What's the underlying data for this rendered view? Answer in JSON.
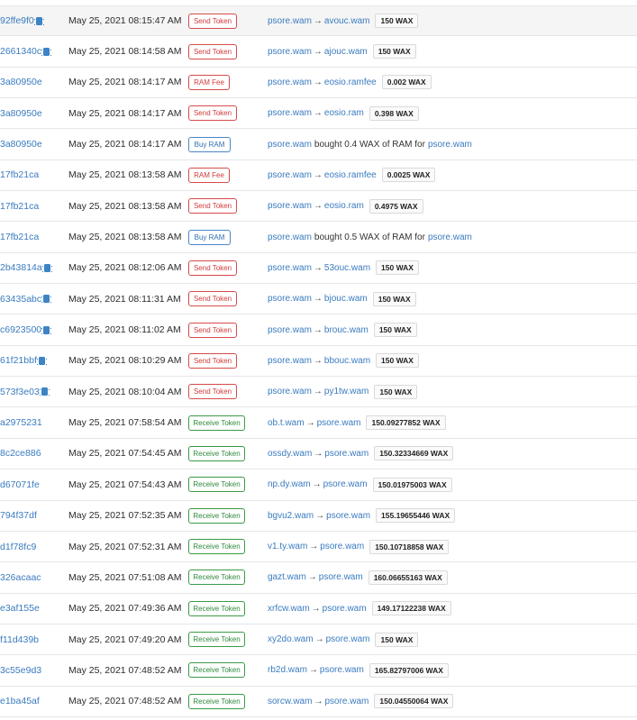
{
  "rows": [
    {
      "hash": "92ffe9f0",
      "cpu": true,
      "date": "May 25, 2021 08:15:47 AM",
      "type": "Send Token",
      "kind": "send",
      "from": "psore.wam",
      "to": "avouc.wam",
      "amount": "150 WAX"
    },
    {
      "hash": "2661340c",
      "cpu": true,
      "date": "May 25, 2021 08:14:58 AM",
      "type": "Send Token",
      "kind": "send",
      "from": "psore.wam",
      "to": "ajouc.wam",
      "amount": "150 WAX"
    },
    {
      "hash": "3a80950e",
      "cpu": false,
      "date": "May 25, 2021 08:14:17 AM",
      "type": "RAM Fee",
      "kind": "ram",
      "from": "psore.wam",
      "to": "eosio.ramfee",
      "amount": "0.002 WAX"
    },
    {
      "hash": "3a80950e",
      "cpu": false,
      "date": "May 25, 2021 08:14:17 AM",
      "type": "Send Token",
      "kind": "send",
      "from": "psore.wam",
      "to": "eosio.ram",
      "amount": "0.398 WAX"
    },
    {
      "hash": "3a80950e",
      "cpu": false,
      "date": "May 25, 2021 08:14:17 AM",
      "type": "Buy RAM",
      "kind": "buy",
      "buyer": "psore.wam",
      "mid": "bought 0.4 WAX of RAM for",
      "receiver": "psore.wam"
    },
    {
      "hash": "17fb21ca",
      "cpu": false,
      "date": "May 25, 2021 08:13:58 AM",
      "type": "RAM Fee",
      "kind": "ram",
      "from": "psore.wam",
      "to": "eosio.ramfee",
      "amount": "0.0025 WAX"
    },
    {
      "hash": "17fb21ca",
      "cpu": false,
      "date": "May 25, 2021 08:13:58 AM",
      "type": "Send Token",
      "kind": "send",
      "from": "psore.wam",
      "to": "eosio.ram",
      "amount": "0.4975 WAX"
    },
    {
      "hash": "17fb21ca",
      "cpu": false,
      "date": "May 25, 2021 08:13:58 AM",
      "type": "Buy RAM",
      "kind": "buy",
      "buyer": "psore.wam",
      "mid": "bought 0.5 WAX of RAM for",
      "receiver": "psore.wam"
    },
    {
      "hash": "2b43814a",
      "cpu": true,
      "date": "May 25, 2021 08:12:06 AM",
      "type": "Send Token",
      "kind": "send",
      "from": "psore.wam",
      "to": "53ouc.wam",
      "amount": "150 WAX"
    },
    {
      "hash": "63435abc",
      "cpu": true,
      "date": "May 25, 2021 08:11:31 AM",
      "type": "Send Token",
      "kind": "send",
      "from": "psore.wam",
      "to": "bjouc.wam",
      "amount": "150 WAX"
    },
    {
      "hash": "c6923500",
      "cpu": true,
      "date": "May 25, 2021 08:11:02 AM",
      "type": "Send Token",
      "kind": "send",
      "from": "psore.wam",
      "to": "brouc.wam",
      "amount": "150 WAX"
    },
    {
      "hash": "61f21bbf",
      "cpu": true,
      "date": "May 25, 2021 08:10:29 AM",
      "type": "Send Token",
      "kind": "send",
      "from": "psore.wam",
      "to": "bbouc.wam",
      "amount": "150 WAX"
    },
    {
      "hash": "573f3e03",
      "cpu": true,
      "date": "May 25, 2021 08:10:04 AM",
      "type": "Send Token",
      "kind": "send",
      "from": "psore.wam",
      "to": "py1tw.wam",
      "amount": "150 WAX"
    },
    {
      "hash": "a2975231",
      "cpu": false,
      "date": "May 25, 2021 07:58:54 AM",
      "type": "Receive Token",
      "kind": "recv",
      "from": "ob.t.wam",
      "to": "psore.wam",
      "amount": "150.09277852 WAX"
    },
    {
      "hash": "8c2ce886",
      "cpu": false,
      "date": "May 25, 2021 07:54:45 AM",
      "type": "Receive Token",
      "kind": "recv",
      "from": "ossdy.wam",
      "to": "psore.wam",
      "amount": "150.32334669 WAX"
    },
    {
      "hash": "d67071fe",
      "cpu": false,
      "date": "May 25, 2021 07:54:43 AM",
      "type": "Receive Token",
      "kind": "recv",
      "from": "np.dy.wam",
      "to": "psore.wam",
      "amount": "150.01975003 WAX"
    },
    {
      "hash": "794f37df",
      "cpu": false,
      "date": "May 25, 2021 07:52:35 AM",
      "type": "Receive Token",
      "kind": "recv",
      "from": "bgvu2.wam",
      "to": "psore.wam",
      "amount": "155.19655446 WAX"
    },
    {
      "hash": "d1f78fc9",
      "cpu": false,
      "date": "May 25, 2021 07:52:31 AM",
      "type": "Receive Token",
      "kind": "recv",
      "from": "v1.ty.wam",
      "to": "psore.wam",
      "amount": "150.10718858 WAX"
    },
    {
      "hash": "326acaac",
      "cpu": false,
      "date": "May 25, 2021 07:51:08 AM",
      "type": "Receive Token",
      "kind": "recv",
      "from": "gazt.wam",
      "to": "psore.wam",
      "amount": "160.06655163 WAX"
    },
    {
      "hash": "e3af155e",
      "cpu": false,
      "date": "May 25, 2021 07:49:36 AM",
      "type": "Receive Token",
      "kind": "recv",
      "from": "xrfcw.wam",
      "to": "psore.wam",
      "amount": "149.17122238 WAX"
    },
    {
      "hash": "f11d439b",
      "cpu": false,
      "date": "May 25, 2021 07:49:20 AM",
      "type": "Receive Token",
      "kind": "recv",
      "from": "xy2do.wam",
      "to": "psore.wam",
      "amount": "150 WAX"
    },
    {
      "hash": "3c55e9d3",
      "cpu": false,
      "date": "May 25, 2021 07:48:52 AM",
      "type": "Receive Token",
      "kind": "recv",
      "from": "rb2d.wam",
      "to": "psore.wam",
      "amount": "165.82797006 WAX"
    },
    {
      "hash": "e1ba45af",
      "cpu": false,
      "date": "May 25, 2021 07:48:52 AM",
      "type": "Receive Token",
      "kind": "recv",
      "from": "sorcw.wam",
      "to": "psore.wam",
      "amount": "150.04550064 WAX"
    }
  ],
  "arrow_glyph": "→",
  "icons": {
    "cpu": "cpu-chip-icon"
  },
  "colors": {
    "link": "#3a7bbf",
    "send": "#d23b3b",
    "buy": "#2f6fb3",
    "receive": "#2e8a3c"
  }
}
